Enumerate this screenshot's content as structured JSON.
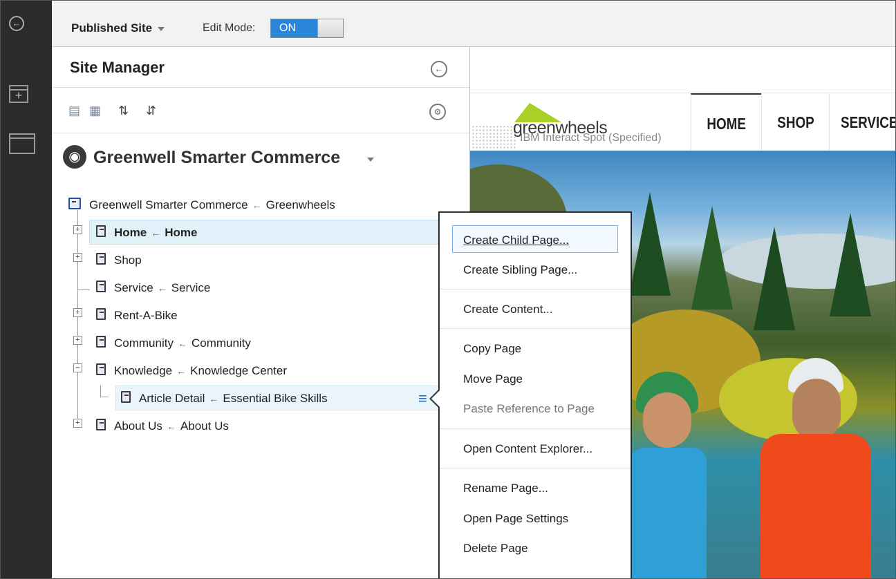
{
  "topbar": {
    "site_selector": "Published Site",
    "edit_mode_label": "Edit Mode:",
    "edit_mode_value": "ON"
  },
  "site_manager": {
    "title": "Site Manager",
    "site_name": "Greenwell Smarter Commerce",
    "tree": {
      "root": {
        "label": "Greenwell Smarter Commerce",
        "mapped_to": "Greenwheels"
      },
      "items": [
        {
          "label": "Home",
          "mapped_to": "Home",
          "expandable": true,
          "selected": true
        },
        {
          "label": "Shop",
          "mapped_to": "",
          "expandable": true
        },
        {
          "label": "Service",
          "mapped_to": "Service",
          "expandable": false
        },
        {
          "label": "Rent-A-Bike",
          "mapped_to": "",
          "expandable": true
        },
        {
          "label": "Community",
          "mapped_to": "Community",
          "expandable": true
        },
        {
          "label": "Knowledge",
          "mapped_to": "Knowledge Center",
          "expandable": true,
          "expanded": true
        },
        {
          "label": "Article Detail",
          "mapped_to": "Essential Bike Skills",
          "child": true,
          "highlighted": true
        },
        {
          "label": "About Us",
          "mapped_to": "About Us",
          "expandable": true
        }
      ]
    }
  },
  "context_menu": {
    "items": [
      {
        "label": "Create Child Page...",
        "focused": true
      },
      {
        "label": "Create Sibling Page..."
      },
      {
        "label": "Create Content..."
      },
      {
        "label": "Copy Page"
      },
      {
        "label": "Move Page"
      },
      {
        "label": "Paste Reference to Page",
        "disabled": true
      },
      {
        "label": "Open Content Explorer..."
      },
      {
        "label": "Rename Page..."
      },
      {
        "label": "Open Page Settings"
      },
      {
        "label": "Delete Page"
      }
    ]
  },
  "preview": {
    "logo_text": "greenwheels",
    "spot_label": "IBM Interact Spot (Specified)",
    "nav": [
      "HOME",
      "SHOP",
      "SERVICE"
    ]
  },
  "icons": {
    "rail": [
      "back-icon",
      "add-page-icon",
      "window-icon"
    ],
    "toolbar": [
      "tree-view-icon",
      "page-edit-icon",
      "move-up-icon",
      "move-down-icon",
      "settings-icon"
    ]
  },
  "colors": {
    "toggle_on": "#2a86d8",
    "selection": "#e0f1fa",
    "logo_green": "#a8d027"
  }
}
